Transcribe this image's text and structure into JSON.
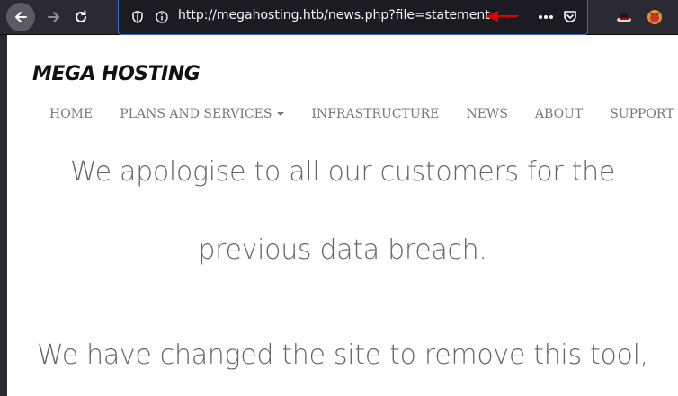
{
  "browser": {
    "url": "http://megahosting.htb/news.php?file=statement"
  },
  "site": {
    "logo": "MEGA HOSTING",
    "nav": [
      {
        "label": "HOME"
      },
      {
        "label": "PLANS AND SERVICES"
      },
      {
        "label": "INFRASTRUCTURE"
      },
      {
        "label": "NEWS"
      },
      {
        "label": "ABOUT"
      },
      {
        "label": "SUPPORT"
      }
    ]
  },
  "content": {
    "line1": "We apologise to all our customers for the",
    "line2": "previous data breach.",
    "line3": "We have changed the site to remove this tool,"
  },
  "colors": {
    "toolbar_bg": "#2b2a33",
    "urlbar_border": "#3a6ac7",
    "annotation_arrow": "#e00000"
  },
  "icons": [
    "back-arrow-icon",
    "forward-arrow-icon",
    "reload-icon",
    "shield-icon",
    "info-icon",
    "more-icon",
    "pocket-icon",
    "extension-hat-icon",
    "extension-fox-icon"
  ]
}
